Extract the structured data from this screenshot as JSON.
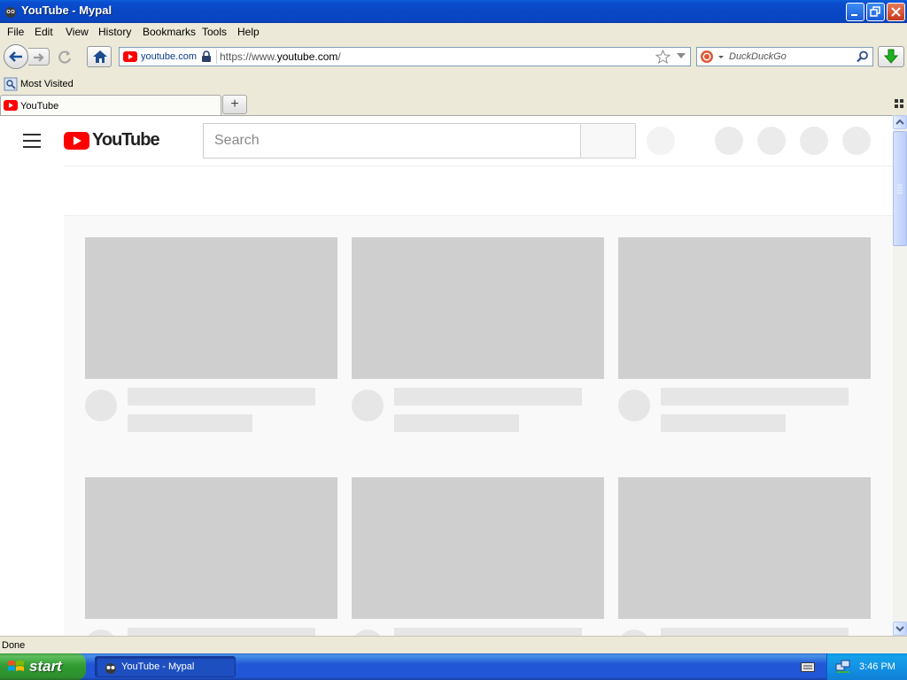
{
  "window": {
    "title": "YouTube - Mypal"
  },
  "menu": [
    "File",
    "Edit",
    "View",
    "History",
    "Bookmarks",
    "Tools",
    "Help"
  ],
  "toolbar": {
    "identity_domain": "youtube.com",
    "url_prefix": "https://www.",
    "url_host": "youtube.com",
    "url_suffix": "/",
    "search_engine_placeholder": "DuckDuckGo"
  },
  "bookmarks": {
    "most_visited": "Most Visited"
  },
  "tabs": [
    {
      "label": "YouTube"
    }
  ],
  "page": {
    "logo_text": "YouTube",
    "search_placeholder": "Search"
  },
  "status": {
    "text": "Done"
  },
  "taskbar": {
    "start_label": "start",
    "task_label": "YouTube - Mypal",
    "clock": "3:46 PM"
  },
  "colors": {
    "youtube_red": "#ff0000",
    "skeleton_thumb": "#cfcfcf",
    "skeleton_line": "#e6e6e6",
    "xp_blue": "#0846c4"
  }
}
